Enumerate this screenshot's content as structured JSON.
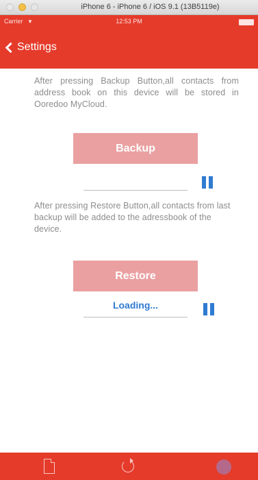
{
  "window": {
    "title": "iPhone 6 - iPhone 6 / iOS 9.1 (13B5119e)"
  },
  "status_bar": {
    "carrier": "Carrier",
    "time": "12:53 PM"
  },
  "nav": {
    "back_label": "Settings"
  },
  "backup": {
    "description": "After pressing Backup Button,all contacts from address book on this device will be stored in Ooredoo MyCloud.",
    "button_label": "Backup"
  },
  "restore": {
    "description": "After pressing Restore Button,all contacts from last backup will be added to the adressbook of the device.",
    "button_label": "Restore",
    "status_text": "Loading..."
  },
  "colors": {
    "brand_red": "#e53b2b",
    "button_pink": "#eaa0a1",
    "accent_blue": "#2f7bd1",
    "body_text": "#8c8c8c"
  },
  "icons": {
    "tab_1": "document-icon",
    "tab_2": "refresh-icon",
    "tab_3": "settings-gear-icon",
    "pause": "pause-icon"
  }
}
